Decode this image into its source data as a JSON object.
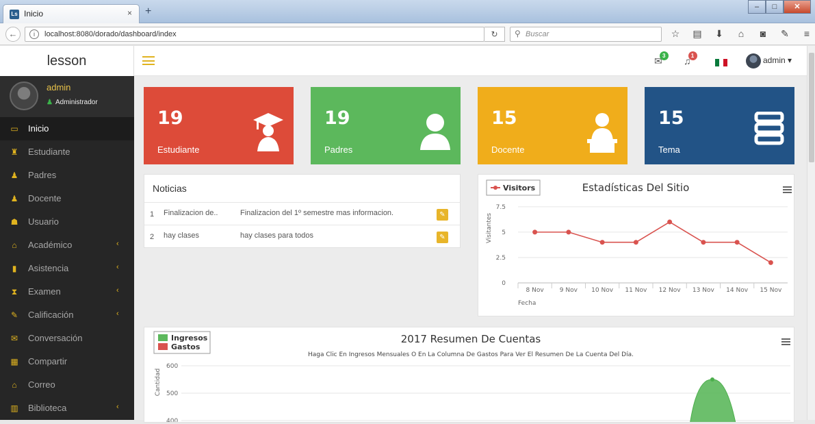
{
  "browser": {
    "tab_title": "Inicio",
    "tab_icon": "Ls",
    "tab_close": "×",
    "new_tab": "+",
    "url": "localhost:8080/dorado/dashboard/index",
    "search_placeholder": "Buscar"
  },
  "app": {
    "brand": "lesson",
    "notifications": {
      "messages_count": "3",
      "alerts_count": "1"
    },
    "user_menu": "admin ▾"
  },
  "sidebar": {
    "profile_name": "admin",
    "profile_role": "Administrador",
    "items": [
      {
        "label": "Inicio",
        "icon": "laptop-icon",
        "active": true,
        "has_submenu": false
      },
      {
        "label": "Estudiante",
        "icon": "student-icon",
        "active": false,
        "has_submenu": false
      },
      {
        "label": "Padres",
        "icon": "user-icon",
        "active": false,
        "has_submenu": false
      },
      {
        "label": "Docente",
        "icon": "teacher-icon",
        "active": false,
        "has_submenu": false
      },
      {
        "label": "Usuario",
        "icon": "users-icon",
        "active": false,
        "has_submenu": false
      },
      {
        "label": "Académico",
        "icon": "bank-icon",
        "active": false,
        "has_submenu": true
      },
      {
        "label": "Asistencia",
        "icon": "clipboard-icon",
        "active": false,
        "has_submenu": true
      },
      {
        "label": "Examen",
        "icon": "hourglass-icon",
        "active": false,
        "has_submenu": true
      },
      {
        "label": "Calificación",
        "icon": "edit-icon",
        "active": false,
        "has_submenu": true
      },
      {
        "label": "Conversación",
        "icon": "envelope-icon",
        "active": false,
        "has_submenu": false
      },
      {
        "label": "Compartir",
        "icon": "film-icon",
        "active": false,
        "has_submenu": false
      },
      {
        "label": "Correo",
        "icon": "inbox-icon",
        "active": false,
        "has_submenu": false
      },
      {
        "label": "Biblioteca",
        "icon": "book-icon",
        "active": false,
        "has_submenu": true
      }
    ]
  },
  "stats": [
    {
      "value": "19",
      "label": "Estudiante",
      "color": "#dd4b39",
      "icon": "graduate-icon"
    },
    {
      "value": "19",
      "label": "Padres",
      "color": "#5cb85c",
      "icon": "user-icon"
    },
    {
      "value": "15",
      "label": "Docente",
      "color": "#f0ad1b",
      "icon": "teacher-icon"
    },
    {
      "value": "15",
      "label": "Tema",
      "color": "#225386",
      "icon": "books-icon"
    }
  ],
  "news": {
    "title": "Noticias",
    "rows": [
      {
        "n": "1",
        "title": "Finalizacion de..",
        "detail": "Finalizacion del 1º semestre mas informacion."
      },
      {
        "n": "2",
        "title": "hay clases",
        "detail": "hay clases para todos"
      }
    ]
  },
  "chart_data": [
    {
      "type": "line",
      "title": "Estadísticas Del Sitio",
      "xlabel": "Fecha",
      "ylabel": "Visitantes",
      "categories": [
        "8 Nov",
        "9 Nov",
        "10 Nov",
        "11 Nov",
        "12 Nov",
        "13 Nov",
        "14 Nov",
        "15 Nov"
      ],
      "series": [
        {
          "name": "Visitors",
          "values": [
            5,
            5,
            4,
            4,
            6,
            4,
            4,
            2
          ]
        }
      ],
      "yticks": [
        0,
        2.5,
        5,
        7.5
      ],
      "ylim": [
        0,
        8.5
      ],
      "color": "#d9534f",
      "grid": true,
      "legend": "top-left"
    },
    {
      "type": "area",
      "title": "2017 Resumen De Cuentas",
      "subtitle": "Haga Clic En Ingresos Mensuales O En La Columna De Gastos Para Ver El Resumen De La Cuenta Del Día.",
      "ylabel": "Cantidad",
      "series": [
        {
          "name": "Ingresos",
          "color": "#5cb85c"
        },
        {
          "name": "Gastos",
          "color": "#d9534f"
        }
      ],
      "yticks": [
        600,
        500,
        400
      ],
      "visible_peak": 550,
      "grid": true,
      "legend": "top-left"
    }
  ]
}
